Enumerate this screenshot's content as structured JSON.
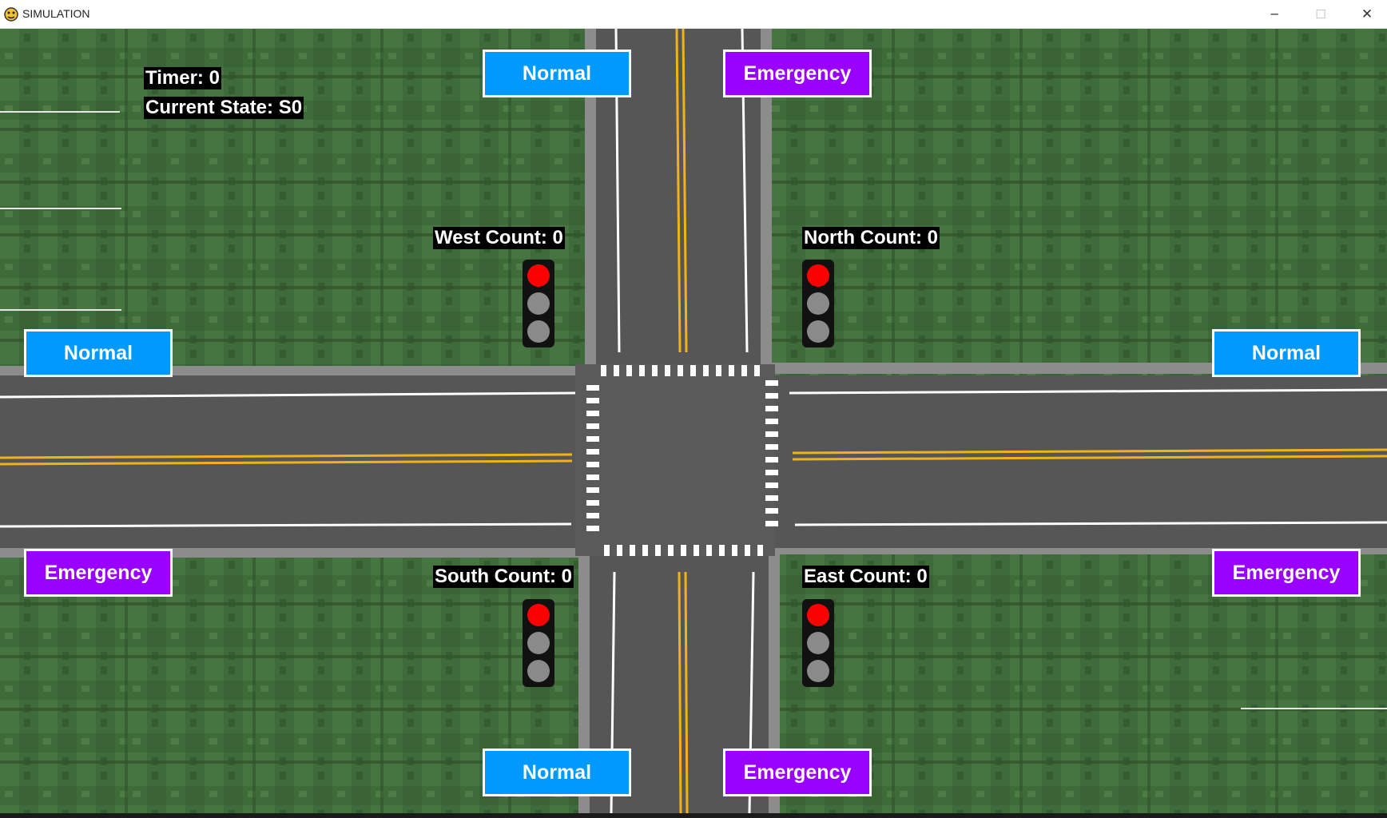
{
  "window": {
    "title": "SIMULATION",
    "controls": {
      "minimize": "─",
      "maximize": "☐",
      "close": "✕"
    }
  },
  "hud": {
    "timer": "Timer: 0",
    "current_state": "Current State: S0"
  },
  "counts": {
    "west": "West Count: 0",
    "north": "North Count: 0",
    "south": "South Count: 0",
    "east": "East Count: 0"
  },
  "buttons": {
    "north_normal": "Normal",
    "north_emergency": "Emergency",
    "west_normal": "Normal",
    "west_emergency": "Emergency",
    "east_normal": "Normal",
    "east_emergency": "Emergency",
    "south_normal": "Normal",
    "south_emergency": "Emergency"
  },
  "lights": {
    "west": "red",
    "north": "red",
    "south": "red",
    "east": "red"
  },
  "colors": {
    "normal_button": "#0099ff",
    "emergency_button": "#9900ff",
    "lamp_on_red": "#ff0000",
    "lamp_off": "#8a8a8a",
    "grass": "#3f6b3a",
    "road": "#555555",
    "center_line": "#f2b21b"
  }
}
